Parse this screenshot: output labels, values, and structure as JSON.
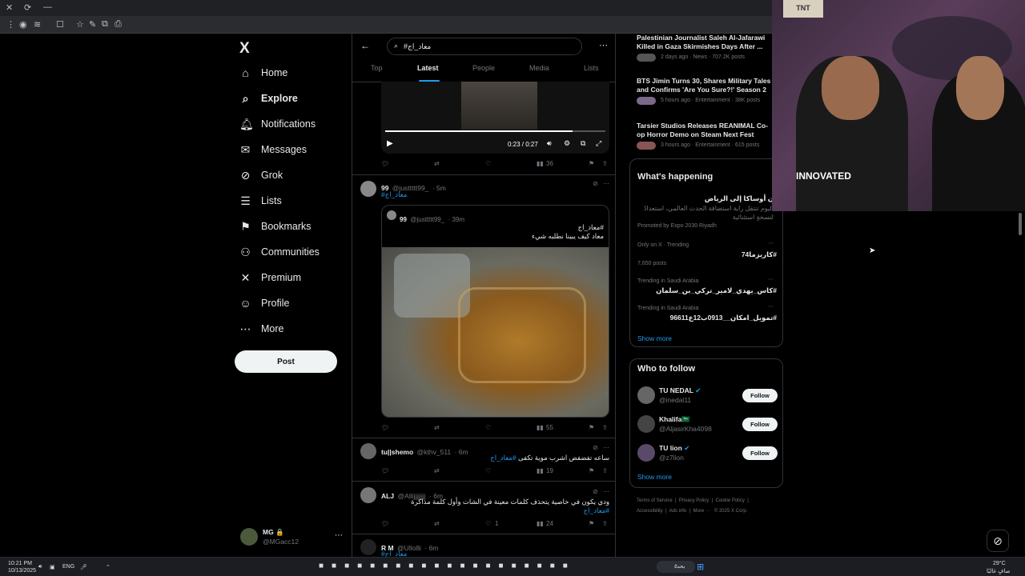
{
  "browser": {
    "buttons": [
      "✕",
      "⟳",
      "—"
    ],
    "toolbar_icons": [
      "⋮",
      "◉",
      "≋",
      "☐",
      "☆",
      "✎",
      "⧉",
      "⎙"
    ]
  },
  "nav": {
    "logo": "X",
    "items": [
      {
        "label": "Home",
        "icon": "⌂",
        "icon_name": "home-icon"
      },
      {
        "label": "Explore",
        "icon": "⌕",
        "icon_name": "search-icon"
      },
      {
        "label": "Notifications",
        "icon": "🔔︎",
        "icon_name": "bell-icon"
      },
      {
        "label": "Messages",
        "icon": "✉",
        "icon_name": "envelope-icon"
      },
      {
        "label": "Grok",
        "icon": "⊘",
        "icon_name": "grok-icon"
      },
      {
        "label": "Lists",
        "icon": "☰",
        "icon_name": "list-icon"
      },
      {
        "label": "Bookmarks",
        "icon": "⚑",
        "icon_name": "bookmark-icon"
      },
      {
        "label": "Communities",
        "icon": "⚇",
        "icon_name": "communities-icon"
      },
      {
        "label": "Premium",
        "icon": "✕",
        "icon_name": "x-premium-icon"
      },
      {
        "label": "Profile",
        "icon": "☺",
        "icon_name": "person-icon"
      },
      {
        "label": "More",
        "icon": "⋯",
        "icon_name": "more-circle-icon"
      }
    ],
    "active": "Explore",
    "post_label": "Post"
  },
  "account": {
    "name": "MG 🔒",
    "handle": "@MGacc12",
    "more": "⋯"
  },
  "search": {
    "query": "#معاد_اج",
    "back": "←",
    "more": "⋯"
  },
  "tabs": [
    "Top",
    "Latest",
    "People",
    "Media",
    "Lists"
  ],
  "video": {
    "time": "0:23 / 0:27",
    "play": "▶",
    "progress": 0.85
  },
  "tweet_video_actions": {
    "views": "36"
  },
  "tweet1": {
    "name": "99",
    "handle": "@justtttt99_",
    "time": "· 5m",
    "hashtag": "#معاد_اج",
    "quote": {
      "name": "99",
      "handle": "@justtttt99_",
      "time": "· 39m",
      "line1": "#معاد_اج",
      "line2": "معاد كيف يبينا نطلبه شيء"
    },
    "views": "55"
  },
  "tweet2": {
    "name": "tu||shemo",
    "handle": "@kthv_511",
    "time": "· 6m",
    "text": "ساعه تفضفض اشرب موية تكفى",
    "hashtag": "#معاد_اج",
    "views": "19"
  },
  "tweet3": {
    "name": "ALJ",
    "handle": "@Allijjjjjjjj",
    "time": "· 6m",
    "text": "ودي يكون في خاصية يتحذف كلمات معينة في الشات وأول كلمة مذاكرة",
    "hashtag": "#معاد_اج",
    "likes": "1",
    "views": "24"
  },
  "tweet4": {
    "name": "R M",
    "handle": "@Ullo8i",
    "time": "· 6m",
    "hashtag": "#معاد_اج"
  },
  "news": [
    {
      "title": "Palestinian Journalist Saleh Al-Jafarawi Killed in Gaza Skirmishes Days After ...",
      "meta": "2 days ago · News · 707.2K posts"
    },
    {
      "title": "BTS Jimin Turns 30, Shares Military Tales and Confirms 'Are You Sure?!' Season 2",
      "meta": "5 hours ago · Entertainment · 38K posts"
    },
    {
      "title": "Tarsier Studios Releases REANIMAL Co-op Horror Demo on Steam Next Fest",
      "meta": "3 hours ago · Entertainment · 615 posts"
    }
  ],
  "happening": {
    "heading": "What's happening",
    "promo_title": "ن أوساكا إلى الرياض",
    "promo_text": "اليوم تنتقل راية استضافة الحدث العالمي، استعدادً لنسخةٍ استثنائية",
    "promo_by": "Promoted by Expo 2030 Riyadh",
    "trends": [
      {
        "context": "Only on X · Trending",
        "name": "#كاريزما74",
        "posts": "7,650 posts"
      },
      {
        "context": "Trending in Saudi Arabia",
        "name": "#كاس_يهدي_لامير_تركي_بن_سلمان",
        "posts": ""
      },
      {
        "context": "Trending in Saudi Arabia",
        "name": "#تمويل_امكان__0913ب12ع96611",
        "posts": ""
      }
    ],
    "show_more": "Show more"
  },
  "who_to_follow": {
    "heading": "Who to follow",
    "users": [
      {
        "name": "TU NEDAL",
        "handle": "@inedal11",
        "follow": "Follow"
      },
      {
        "name": "Khalifa🇸🇦",
        "handle": "@AljasirKha4098",
        "follow": "Follow"
      },
      {
        "name": "TU lion",
        "handle": "@z7lion",
        "follow": "Follow"
      }
    ],
    "show_more": "Show more"
  },
  "footer": [
    "Terms of Service",
    "Privacy Policy",
    "Cookie Policy",
    "Accessibility",
    "Ads info",
    "More ···",
    "© 2025 X Corp."
  ],
  "webcam": {
    "shirt_text": "INNOVATED",
    "sign": "TNT"
  },
  "taskbar": {
    "time": "10:21 PM",
    "date": "10/13/2025",
    "lang": "ENG",
    "search": "بحث",
    "weather": "29°C",
    "weather_desc": "صافٍ غالبًا"
  },
  "colors": {
    "accent": "#1d9bf0",
    "bg": "#000000",
    "muted": "#71767b"
  }
}
